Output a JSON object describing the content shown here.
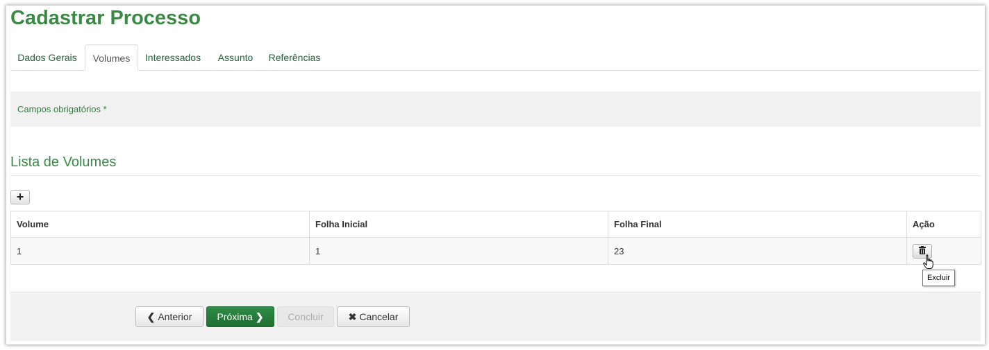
{
  "page": {
    "title": "Cadastrar Processo"
  },
  "tabs": [
    {
      "label": "Dados Gerais",
      "active": false
    },
    {
      "label": "Volumes",
      "active": true
    },
    {
      "label": "Interessados",
      "active": false
    },
    {
      "label": "Assunto",
      "active": false
    },
    {
      "label": "Referências",
      "active": false
    }
  ],
  "info": {
    "required_note": "Campos obrigatórios *"
  },
  "section": {
    "title": "Lista de Volumes",
    "add_icon": "plus-icon"
  },
  "table": {
    "headers": [
      "Volume",
      "Folha Inicial",
      "Folha Final",
      "Ação"
    ],
    "rows": [
      {
        "volume": "1",
        "folha_inicial": "1",
        "folha_final": "23",
        "action_icon": "trash-icon"
      }
    ]
  },
  "tooltip": {
    "text": "Excluir"
  },
  "footer": {
    "previous_label": "Anterior",
    "next_label": "Próxima",
    "finish_label": "Concluir",
    "cancel_label": "Cancelar"
  },
  "colors": {
    "brand_green": "#3a8a46",
    "primary_button": "#1f6e33"
  }
}
